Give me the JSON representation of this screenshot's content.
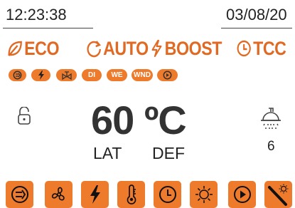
{
  "header": {
    "time": "12:23:38",
    "date": "03/08/20"
  },
  "modes": [
    {
      "label": "ECO",
      "icon": "leaf-icon"
    },
    {
      "label": "AUTO",
      "icon": "cycle-arrow-icon"
    },
    {
      "label": "BOOST",
      "icon": "lightning-bolt-icon"
    },
    {
      "label": "TCC",
      "icon": "clock-icon"
    }
  ],
  "status_pills": [
    {
      "label": "",
      "icon": "power-plug-icon"
    },
    {
      "label": "",
      "icon": "lightning-bolt-icon"
    },
    {
      "label": "",
      "icon": "valve-icon"
    },
    {
      "label": "DI"
    },
    {
      "label": "WE"
    },
    {
      "label": "WND"
    },
    {
      "label": "",
      "icon": "play-icon"
    }
  ],
  "main": {
    "temperature": "60 ºC",
    "left_label": "LAT",
    "right_label": "DEF",
    "shower_count": "6"
  },
  "bottom_buttons": [
    {
      "icon": "power-plug-icon"
    },
    {
      "icon": "fan-icon"
    },
    {
      "icon": "lightning-bolt-icon"
    },
    {
      "icon": "thermometer-icon"
    },
    {
      "icon": "clock-icon"
    },
    {
      "icon": "sun-icon"
    },
    {
      "icon": "play-icon"
    },
    {
      "icon": "heater-rod-icon"
    }
  ],
  "colors": {
    "accent": "#ee7a2c",
    "mode_text": "#e06a23",
    "text": "#333333",
    "icon_dark": "#111111"
  }
}
